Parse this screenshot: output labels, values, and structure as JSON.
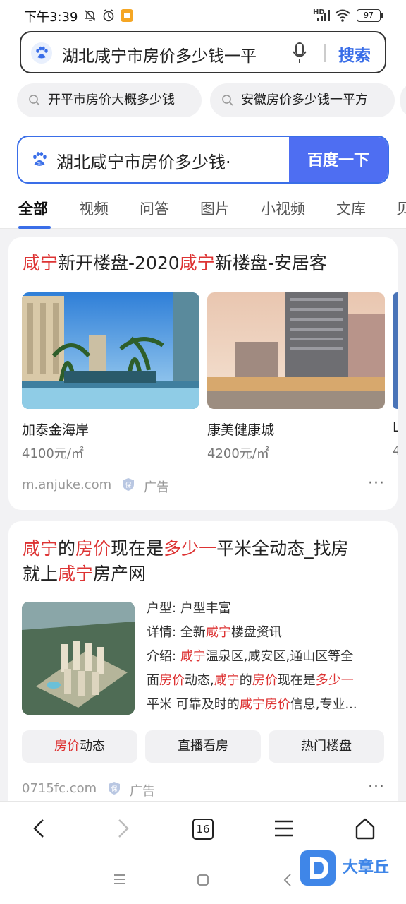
{
  "status_bar": {
    "time": "下午3:39",
    "battery": "97",
    "network": "HD"
  },
  "top_search": {
    "query": "湖北咸宁市房价多少钱一平",
    "search_label": "搜索",
    "suggestions": [
      "开平市房价大概多少钱",
      "安徽房价多少钱一平方"
    ]
  },
  "result_search": {
    "query": "湖北咸宁市房价多少钱·",
    "button_label": "百度一下"
  },
  "tabs": [
    "全部",
    "视频",
    "问答",
    "图片",
    "小视频",
    "文库",
    "贝"
  ],
  "card1": {
    "title_parts": [
      "咸宁",
      "新开楼盘-2020",
      "咸宁",
      "新楼盘-安居客"
    ],
    "properties": [
      {
        "name": "加泰金海岸",
        "price": "4100元/㎡"
      },
      {
        "name": "康美健康城",
        "price": "4200元/㎡"
      },
      {
        "name": "L",
        "price": "4"
      }
    ],
    "domain": "m.anjuke.com",
    "ad_label": "广告",
    "more": "···"
  },
  "card2": {
    "title_line1_parts": [
      "咸宁",
      "的",
      "房价",
      "现在是",
      "多少一",
      "平米全动态_找房"
    ],
    "title_line2_parts": [
      "就上",
      "咸宁",
      "房产网"
    ],
    "info": {
      "type_label": "户型:",
      "type_value": "户型丰富",
      "detail_label": "详情:",
      "detail_parts": [
        "全新",
        "咸宁",
        "楼盘资讯"
      ],
      "intro_label": "介绍:",
      "intro_l1_parts": [
        "咸宁",
        "温泉区,咸安区,通山区等全"
      ],
      "intro_l2_parts": [
        "面",
        "房价",
        "动态,",
        "咸宁",
        "的",
        "房价",
        "现在是",
        "多少一"
      ],
      "intro_l3_parts": [
        "平米 可靠及时的",
        "咸宁房价",
        "信息,专业..."
      ]
    },
    "pills": [
      {
        "parts": [
          "房价",
          "动态"
        ]
      },
      {
        "parts": [
          "直播看房"
        ]
      },
      {
        "parts": [
          "热门楼盘"
        ]
      }
    ],
    "domain": "0715fc.com",
    "ad_label": "广告",
    "more": "···"
  },
  "browser_nav": {
    "tab_count": "16"
  },
  "watermark": "大章丘",
  "colors": {
    "accent": "#3a6ee8",
    "button": "#4e6ef2",
    "highlight": "#d33333"
  }
}
